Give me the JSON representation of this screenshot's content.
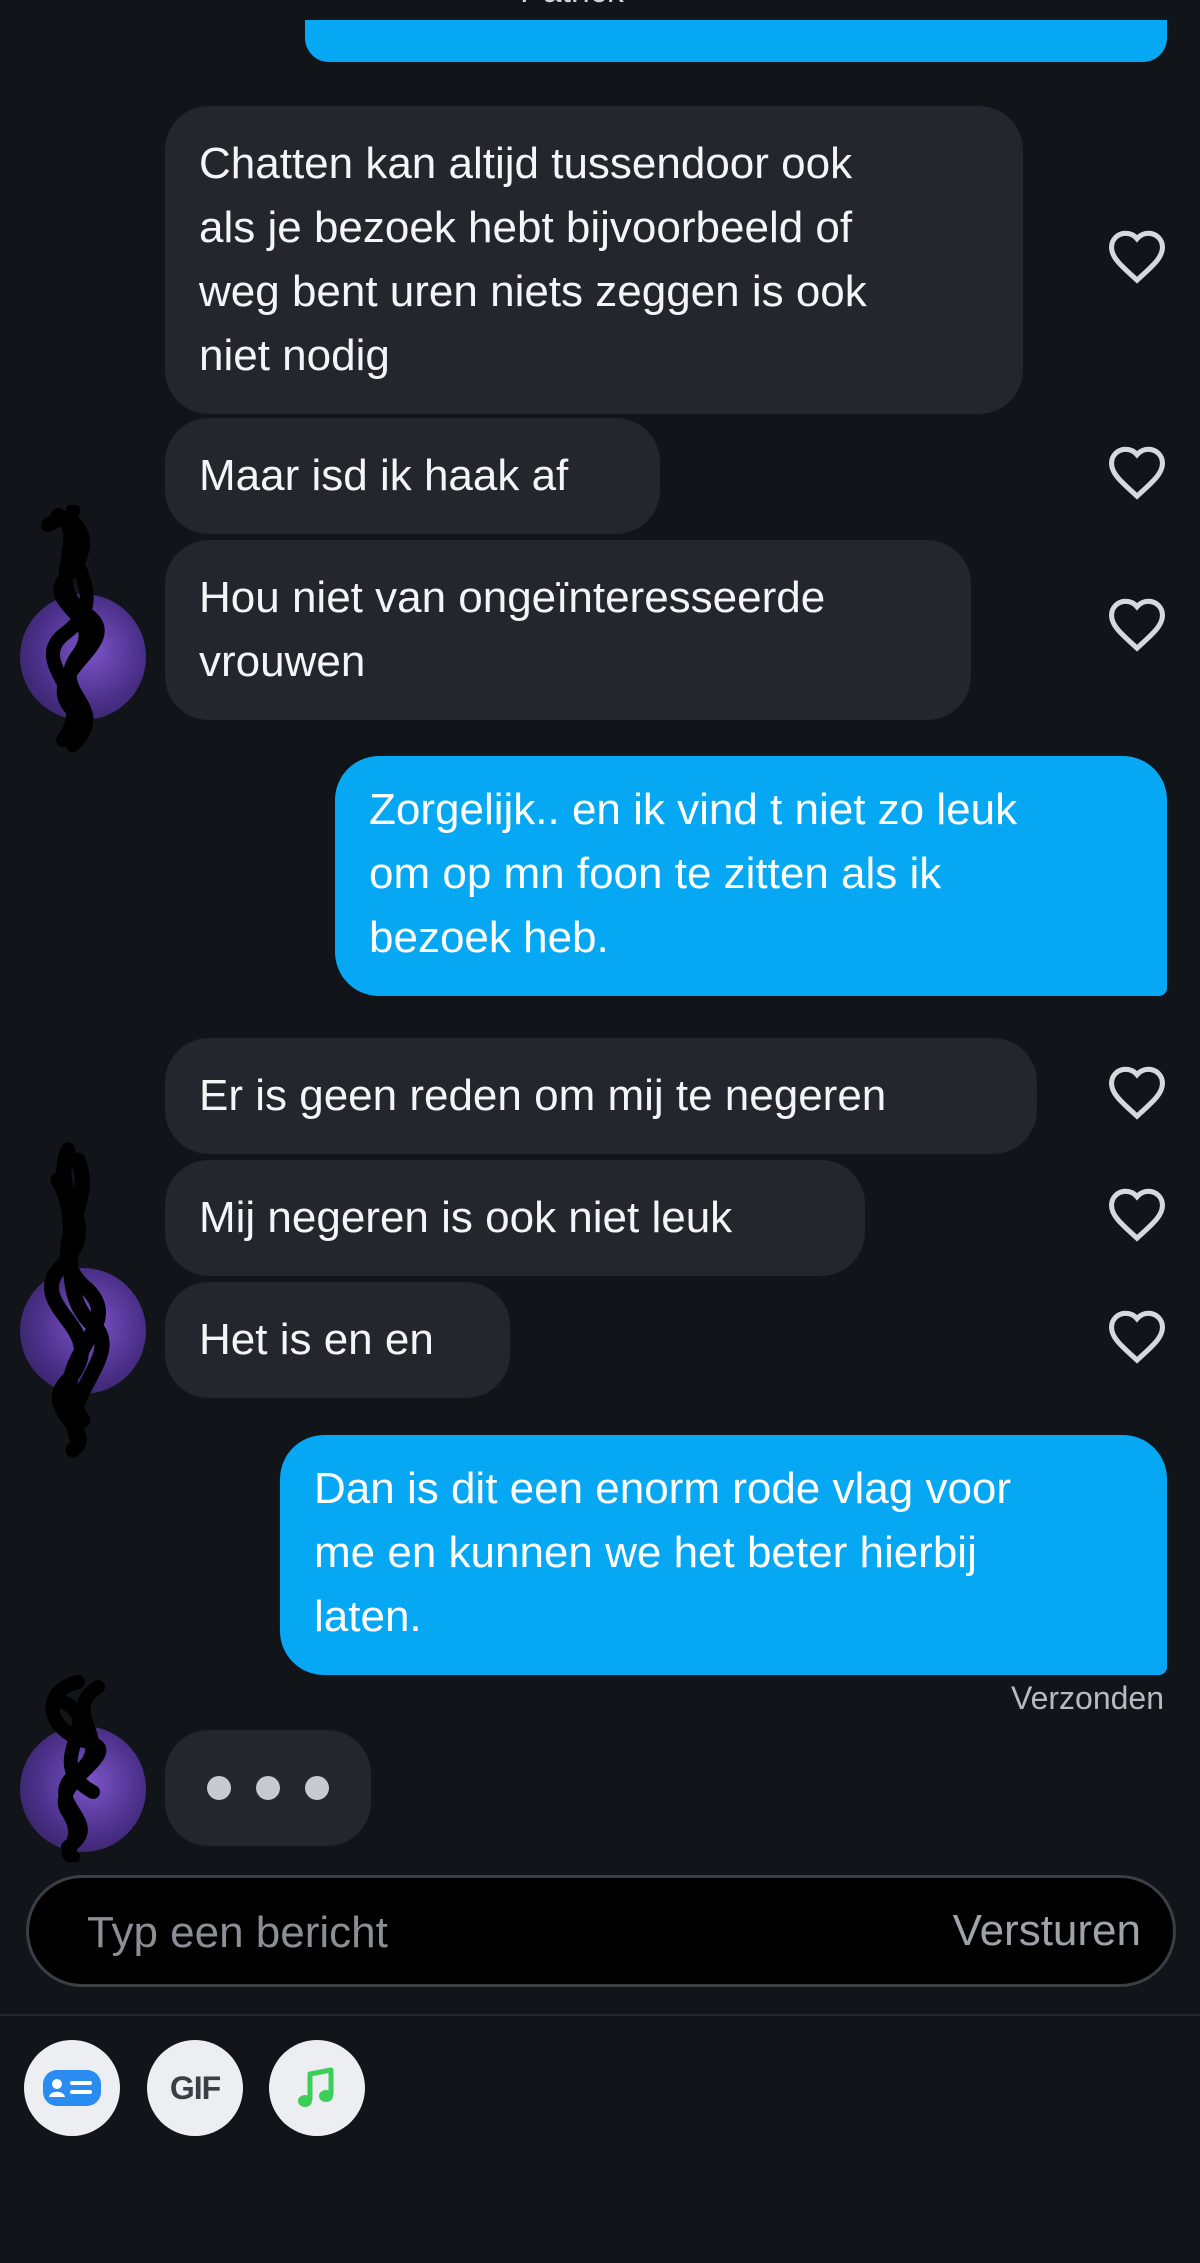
{
  "header": {
    "contact_name": "Patrick"
  },
  "messages": [
    {
      "direction": "incoming",
      "text": "Chatten kan altijd tussendoor ook\nals je bezoek hebt bijvoorbeeld of\nweg bent uren niets zeggen is ook\nniet nodig"
    },
    {
      "direction": "incoming",
      "text": "Maar isd ik haak af"
    },
    {
      "direction": "incoming",
      "text": "Hou niet van ongeïnteresseerde\nvrouwen"
    },
    {
      "direction": "outgoing",
      "text": "Zorgelijk.. en ik vind t niet zo leuk\nom op mn foon te zitten als ik\nbezoek heb."
    },
    {
      "direction": "incoming",
      "text": "Er is geen reden om mij te negeren"
    },
    {
      "direction": "incoming",
      "text": "Mij negeren is ook niet leuk"
    },
    {
      "direction": "incoming",
      "text": "Het is en en"
    },
    {
      "direction": "outgoing",
      "text": "Dan is dit een enorm rode vlag voor\nme en kunnen we het beter hierbij\nlaten."
    }
  ],
  "delivery_status": "Verzonden",
  "composer": {
    "placeholder": "Typ een bericht",
    "send_label": "Versturen"
  },
  "toolbar": {
    "gif_label": "GIF",
    "icons": [
      "id-card-icon",
      "gif-icon",
      "music-note-icon"
    ]
  },
  "colors": {
    "background": "#111418",
    "incoming_bubble": "#23262c",
    "outgoing_bubble": "#06a8f4",
    "music_green": "#3ccf58",
    "card_blue": "#2a8cf0"
  }
}
